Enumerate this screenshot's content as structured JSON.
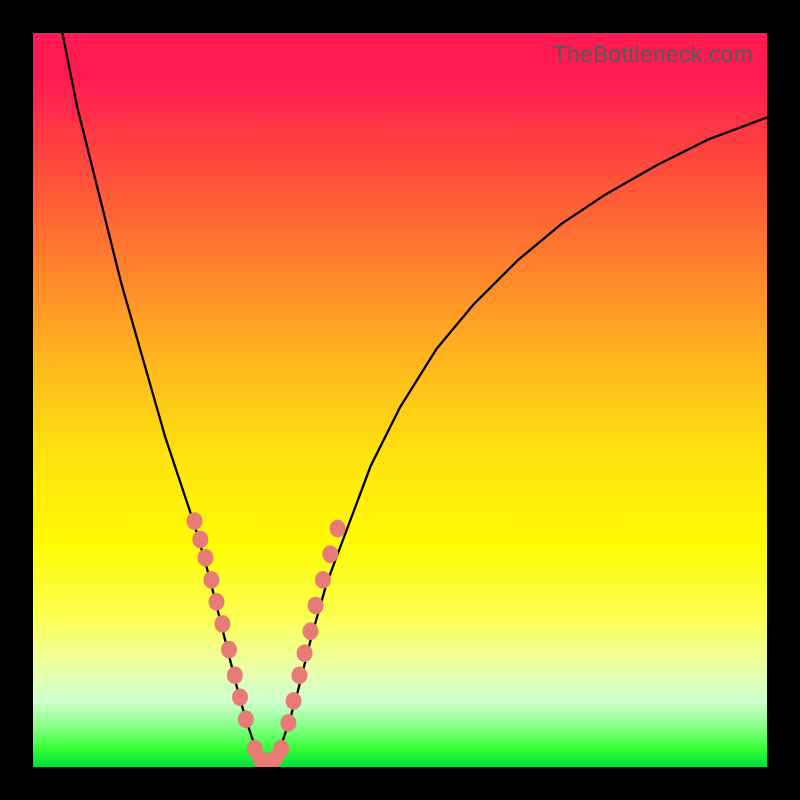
{
  "watermark": "TheBottleneck.com",
  "chart_data": {
    "type": "line",
    "title": "",
    "xlabel": "",
    "ylabel": "",
    "xlim": [
      0,
      100
    ],
    "ylim": [
      0,
      100
    ],
    "series": [
      {
        "name": "left-curve",
        "x": [
          4,
          5,
          6,
          8,
          10,
          12,
          14,
          16,
          18,
          20,
          22,
          24,
          25,
          26,
          27,
          28,
          29,
          30,
          31,
          32
        ],
        "y": [
          100,
          95,
          90,
          82,
          74,
          66,
          59,
          52,
          45,
          39,
          33,
          26,
          22,
          18,
          14,
          10,
          6.5,
          3.5,
          1.5,
          0.5
        ]
      },
      {
        "name": "right-curve",
        "x": [
          32,
          33,
          34,
          35,
          36,
          37,
          38,
          40,
          43,
          46,
          50,
          55,
          60,
          66,
          72,
          78,
          85,
          92,
          100
        ],
        "y": [
          0.5,
          1.5,
          3.5,
          6.5,
          10,
          14,
          18,
          25,
          33,
          41,
          49,
          57,
          63,
          69,
          74,
          78,
          82,
          85.5,
          88.5
        ]
      }
    ],
    "markers": {
      "color": "#e77c76",
      "radius_abs": 8,
      "left_points": [
        [
          22.0,
          33.5
        ],
        [
          22.8,
          31.0
        ],
        [
          23.5,
          28.5
        ],
        [
          24.3,
          25.5
        ],
        [
          25.0,
          22.5
        ],
        [
          25.8,
          19.5
        ],
        [
          26.7,
          16.0
        ],
        [
          27.5,
          12.5
        ],
        [
          28.2,
          9.5
        ],
        [
          29.0,
          6.5
        ]
      ],
      "valley_points": [
        [
          30.2,
          2.5
        ],
        [
          31.0,
          1.0
        ],
        [
          32.0,
          0.7
        ],
        [
          33.0,
          1.2
        ],
        [
          33.8,
          2.5
        ]
      ],
      "right_points": [
        [
          34.8,
          6.0
        ],
        [
          35.5,
          9.0
        ],
        [
          36.3,
          12.5
        ],
        [
          37.0,
          15.5
        ],
        [
          37.8,
          18.5
        ],
        [
          38.5,
          22.0
        ],
        [
          39.5,
          25.5
        ],
        [
          40.5,
          29.0
        ],
        [
          41.5,
          32.5
        ]
      ]
    },
    "gradient_stops": [
      {
        "pct": 0,
        "color": "#ff1a52"
      },
      {
        "pct": 30,
        "color": "#ff7a2e"
      },
      {
        "pct": 58,
        "color": "#ffe40d"
      },
      {
        "pct": 80,
        "color": "#fbff57"
      },
      {
        "pct": 95,
        "color": "#7cff7c"
      },
      {
        "pct": 100,
        "color": "#00dd3c"
      }
    ]
  }
}
